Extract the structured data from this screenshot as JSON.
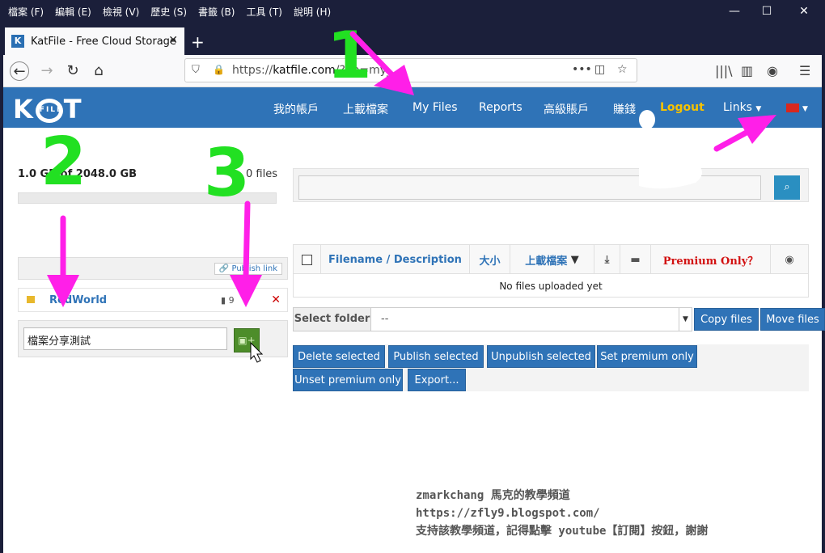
{
  "menubar": {
    "items": [
      "檔案 (F)",
      "編輯 (E)",
      "檢視 (V)",
      "歷史 (S)",
      "書籤 (B)",
      "工具 (T)",
      "說明 (H)"
    ],
    "minimize": "—",
    "maximize": "☐",
    "close": "✕"
  },
  "tab": {
    "favicon": "K",
    "title": "KatFile - Free Cloud Storage",
    "close": "✕",
    "new_tab": "+"
  },
  "nav": {
    "back": "←",
    "forward": "→",
    "reload": "↻",
    "home": "⌂",
    "url_domain": "katfile.com",
    "url_prefix": "https://",
    "url_rest": "/?op=my_",
    "page_actions": "•••",
    "pocket": "◫",
    "star": "☆",
    "library": "|||\\",
    "sidebar": "▥",
    "account": "◉",
    "menu": "☰"
  },
  "site": {
    "logo_k": "K",
    "logo_file": "FILE",
    "logo_t": "T",
    "nav": {
      "my_account": "我的帳戶",
      "upload": "上載檔案",
      "my_files": "My Files",
      "reports": "Reports",
      "premium": "高級賬戶",
      "earn": "賺錢",
      "logout": "Logout",
      "links": "Links"
    }
  },
  "storage": {
    "used": "1.0 GB of 2048.0 GB",
    "files": "0 files",
    "fill_fraction": 0
  },
  "folders": {
    "publish_link": "Publish link",
    "rows": [
      {
        "name": "RedWorld",
        "count": "9",
        "delete": "✕"
      }
    ],
    "new_folder_value": "檔案分享測試"
  },
  "search": {
    "button": "⌕"
  },
  "table": {
    "columns": {
      "filename": "Filename / Description",
      "size": "大小",
      "uploaded": "上載檔案",
      "premium": "Premium Only？"
    },
    "empty": "No files uploaded yet"
  },
  "folder_select": {
    "label": "Select folder",
    "value": "--",
    "copy": "Copy files",
    "move": "Move files"
  },
  "actions": {
    "delete": "Delete selected",
    "publish": "Publish selected",
    "unpublish": "Unpublish selected",
    "premium": "Set premium only",
    "unpremium": "Unset premium only",
    "export": "Export..."
  },
  "annotations": {
    "n1": "1",
    "n2": "2",
    "n3": "3"
  },
  "watermark": {
    "line1": "zmarkchang 馬克的教學頻道",
    "line2": "https://zfly9.blogspot.com/",
    "line3": "支持該教學頻道，記得點擊 youtube【訂閱】按鈕，謝謝"
  },
  "colors": {
    "header": "#2f73b7",
    "annotation_green": "#22e022",
    "annotation_magenta": "#ff1fe8",
    "logout": "#f6c200"
  }
}
